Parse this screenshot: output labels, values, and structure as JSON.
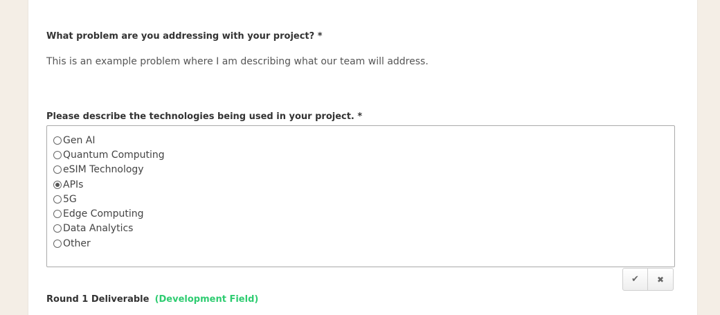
{
  "form": {
    "question1": {
      "label": "What problem are you addressing with your project? *",
      "answer": "This is an example problem where I am describing what our team will address."
    },
    "question2": {
      "label": "Please describe the technologies being used in your project. *",
      "selected": "APIs",
      "options": [
        {
          "label": "Gen AI",
          "checked": false
        },
        {
          "label": "Quantum Computing",
          "checked": false
        },
        {
          "label": "eSIM Technology",
          "checked": false
        },
        {
          "label": "APIs",
          "checked": true
        },
        {
          "label": "5G",
          "checked": false
        },
        {
          "label": "Edge Computing",
          "checked": false
        },
        {
          "label": "Data Analytics",
          "checked": false
        },
        {
          "label": "Other",
          "checked": false
        }
      ]
    },
    "editor_buttons": {
      "confirm_icon": "✔",
      "cancel_icon": "✖"
    },
    "deliverable": {
      "label": "Round 1 Deliverable",
      "tag": "(Development Field)"
    }
  },
  "colors": {
    "background": "#f4eee6",
    "panel": "#ffffff",
    "dev_tag": "#2ecc71"
  }
}
